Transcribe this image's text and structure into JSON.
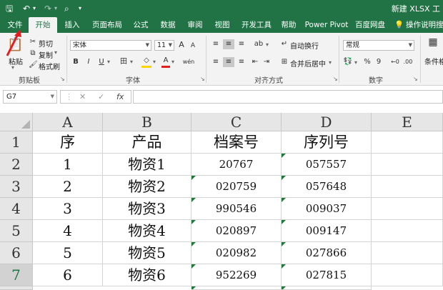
{
  "titlebar": {
    "save_icon": "save-icon",
    "undo_icon": "undo-icon",
    "redo_icon": "redo-icon",
    "preview_icon": "print-preview-icon",
    "customize_icon": "customize-quick-access-icon",
    "doc_title": "新建 XLSX 工"
  },
  "tabs": [
    "文件",
    "开始",
    "插入",
    "页面布局",
    "公式",
    "数据",
    "审阅",
    "视图",
    "开发工具",
    "帮助",
    "Power Pivot",
    "百度网盘",
    "操作说明搜"
  ],
  "ribbon": {
    "clipboard": {
      "paste": "粘贴",
      "cut": "剪切",
      "copy": "复制",
      "format_painter": "格式刷",
      "label": "剪贴板"
    },
    "font": {
      "name": "宋体",
      "size": "11",
      "grow": "A",
      "shrink": "A",
      "bold": "B",
      "italic": "I",
      "underline": "U",
      "borders": "田",
      "fill": "◇",
      "color": "A",
      "wen": "wén",
      "label": "字体"
    },
    "alignment": {
      "wrap": "自动换行",
      "merge": "合并后居中",
      "label": "对齐方式"
    },
    "number": {
      "format": "常规",
      "percent": "%",
      "comma": "9",
      "label": "数字"
    },
    "styles": {
      "cond": "条件格"
    }
  },
  "formula_bar": {
    "name_box": "G7",
    "cancel": "✕",
    "enter": "✓",
    "fx": "fx",
    "value": ""
  },
  "grid": {
    "columns": [
      "A",
      "B",
      "C",
      "D",
      "E"
    ],
    "rows": [
      "1",
      "2",
      "3",
      "4",
      "5",
      "6",
      "7"
    ],
    "active_row": "7",
    "header": [
      "序",
      "产品",
      "档案号",
      "序列号"
    ],
    "data": [
      {
        "seq": "1",
        "product": "物资1",
        "archive": "20767",
        "serial": "057557"
      },
      {
        "seq": "2",
        "product": "物资2",
        "archive": "020759",
        "serial": "057648"
      },
      {
        "seq": "3",
        "product": "物资3",
        "archive": "990546",
        "serial": "009037"
      },
      {
        "seq": "4",
        "product": "物资4",
        "archive": "020897",
        "serial": "009147"
      },
      {
        "seq": "5",
        "product": "物资5",
        "archive": "020982",
        "serial": "027866"
      },
      {
        "seq": "6",
        "product": "物资6",
        "archive": "952269",
        "serial": "027815"
      }
    ]
  },
  "colors": {
    "excel_green": "#217346",
    "ribbon_bg": "#f3f3f3",
    "error_triangle": "#1f7a3a",
    "annotation_arrow": "#e02020"
  }
}
